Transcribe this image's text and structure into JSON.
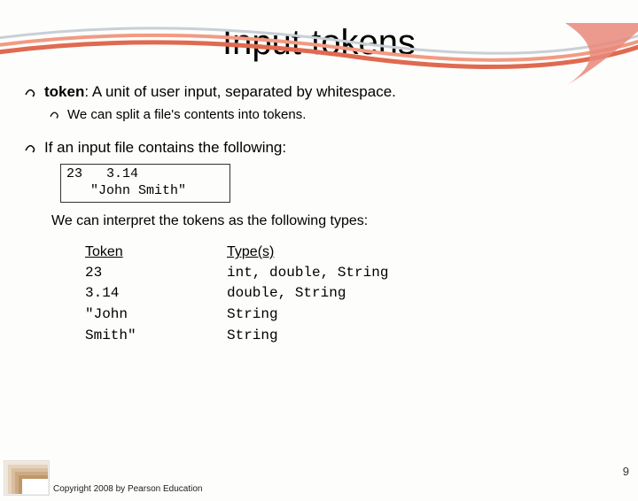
{
  "title": "Input tokens",
  "bullets": {
    "main1_bold": "token",
    "main1_rest": ": A unit of user input, separated by whitespace.",
    "sub1": "We can split a file's contents into tokens.",
    "main2": "If an input file contains the following:"
  },
  "codebox": "23   3.14\n   \"John Smith\"",
  "interp": "We can interpret the tokens as the following types:",
  "table": {
    "head1": "Token",
    "head2": "Type(s)",
    "rows": [
      {
        "token": "23",
        "types": "int, double, String"
      },
      {
        "token": "3.14",
        "types": "double, String"
      },
      {
        "token": "\"John",
        "types": "String"
      },
      {
        "token": "Smith\"",
        "types": "String"
      }
    ]
  },
  "page_number": "9",
  "copyright": "Copyright 2008 by Pearson Education"
}
